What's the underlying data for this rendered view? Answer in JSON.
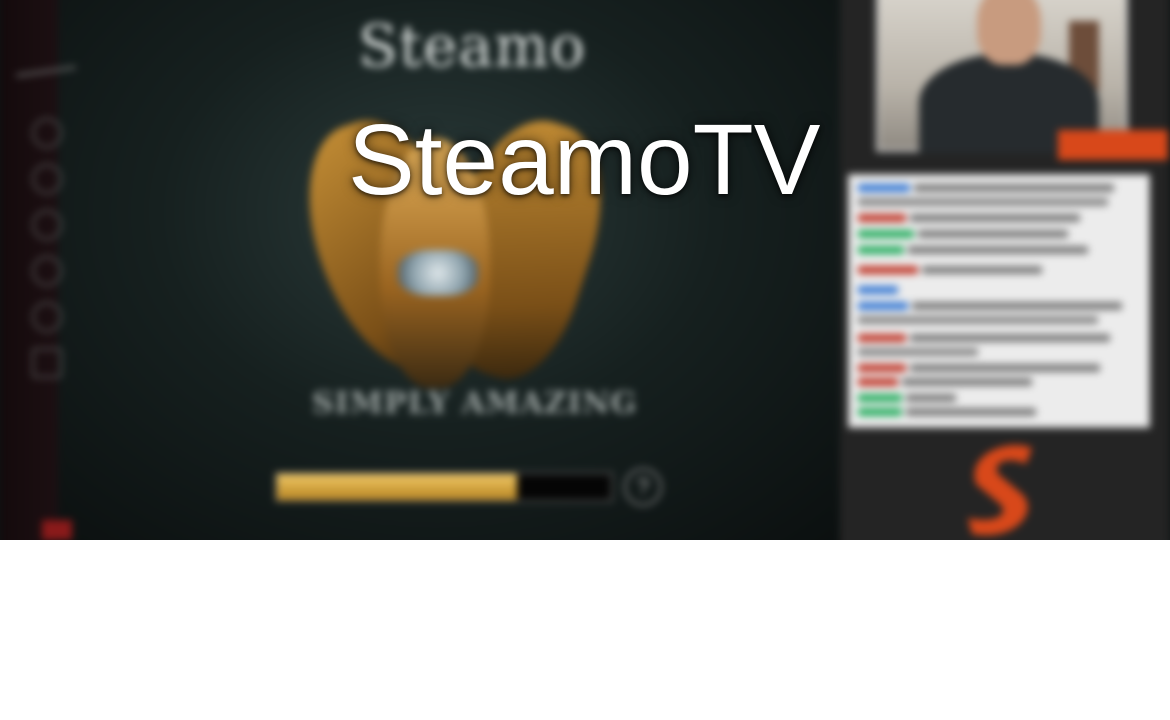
{
  "banner": {
    "title": "SteamoTV"
  },
  "game": {
    "logo_text": "Steamo",
    "result_text": "SIMPLY AMAZING",
    "xp_progress": 0.72
  },
  "colors": {
    "title_text": "#ffffff",
    "xp_fill": "#e1b04a",
    "brand_orange": "#d8481a",
    "chat_background": "#ececec"
  },
  "icons": [
    "help-icon",
    "brand-logo-icon"
  ]
}
